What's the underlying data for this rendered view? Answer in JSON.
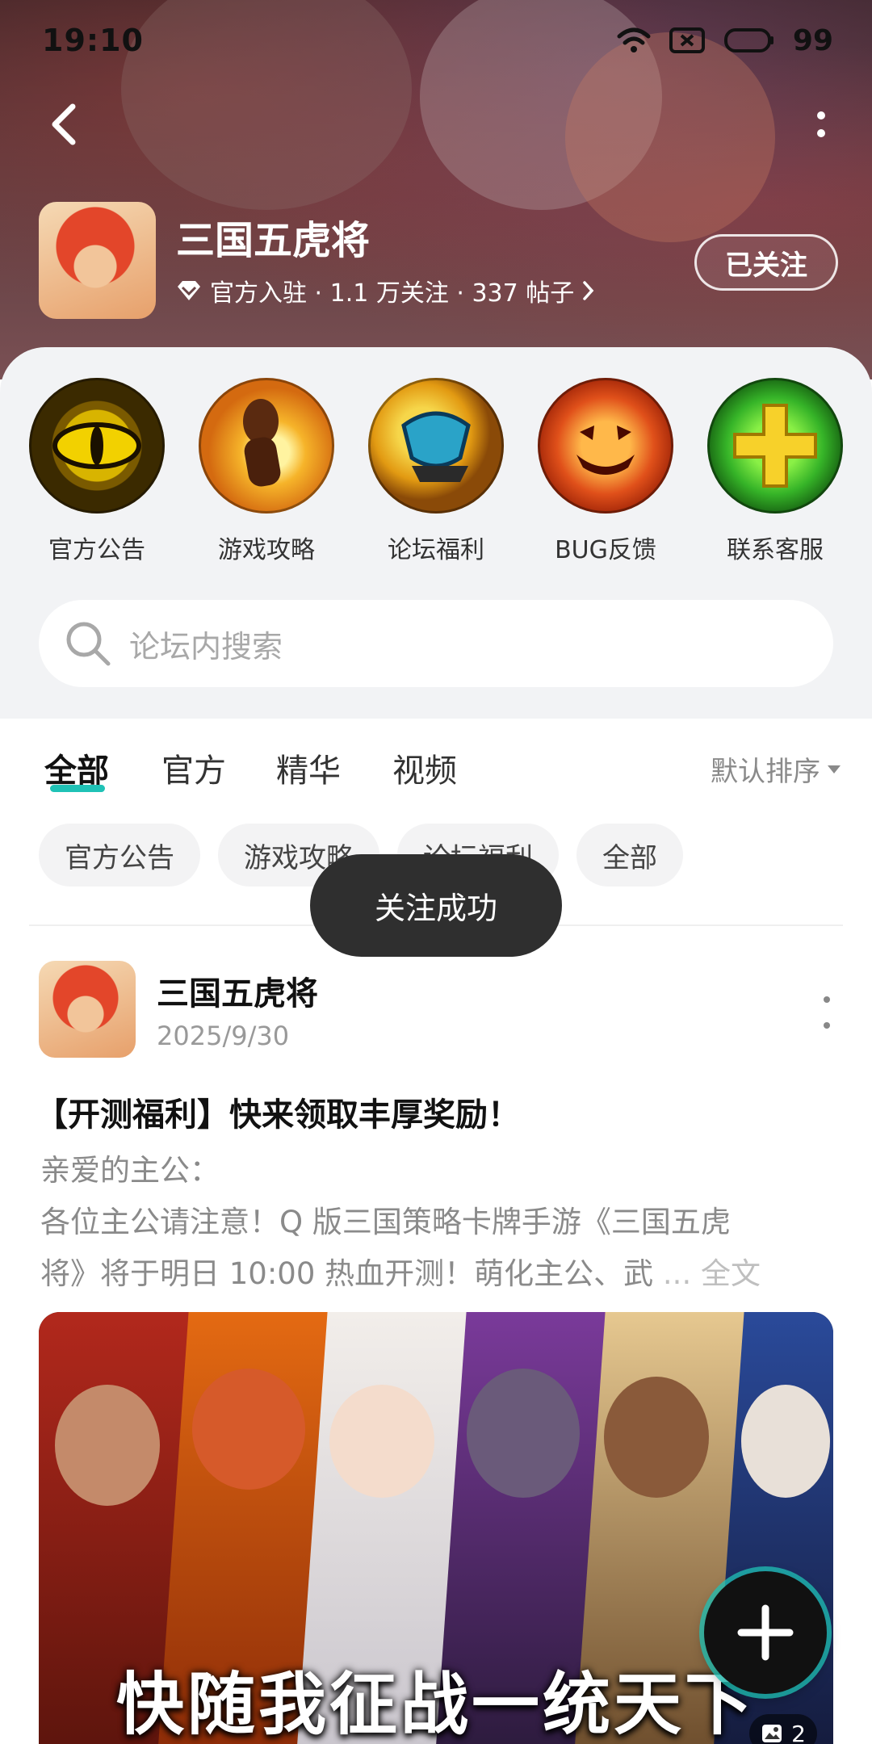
{
  "status_bar": {
    "time": "19:10",
    "battery": "99"
  },
  "forum": {
    "title": "三国五虎将",
    "meta": "官方入驻 · 1.1 万关注 · 337 帖子",
    "follow_label": "已关注"
  },
  "quick_entries": [
    {
      "label": "官方公告",
      "icon": "dragon-eye-icon"
    },
    {
      "label": "游戏攻略",
      "icon": "strategy-hand-icon"
    },
    {
      "label": "论坛福利",
      "icon": "gift-fist-icon"
    },
    {
      "label": "BUG反馈",
      "icon": "pumpkin-icon"
    },
    {
      "label": "联系客服",
      "icon": "plus-cross-icon"
    }
  ],
  "search": {
    "placeholder": "论坛内搜索"
  },
  "tabs": [
    {
      "label": "全部",
      "active": true
    },
    {
      "label": "官方"
    },
    {
      "label": "精华"
    },
    {
      "label": "视频"
    }
  ],
  "sort_label": "默认排序",
  "chips": [
    "官方公告",
    "游戏攻略",
    "论坛福利",
    "全部"
  ],
  "toast": "关注成功",
  "post": {
    "author": "三国五虎将",
    "date": "2025/9/30",
    "title": "【开测福利】快来领取丰厚奖励！",
    "body_lines": [
      "亲爱的主公：",
      " 各位主公请注意！Q 版三国策略卡牌手游《三国五虎",
      "将》将于明日 10:00 热血开测！萌化主公、武 "
    ],
    "ellipsis": "...",
    "read_more": "全文",
    "image_caption": "快随我征战一统天下",
    "image_count": "2"
  },
  "colors": {
    "accent": "#1fc2b6",
    "toast_bg": "#2f2f2f",
    "panel_bg": "#f2f3f5"
  }
}
